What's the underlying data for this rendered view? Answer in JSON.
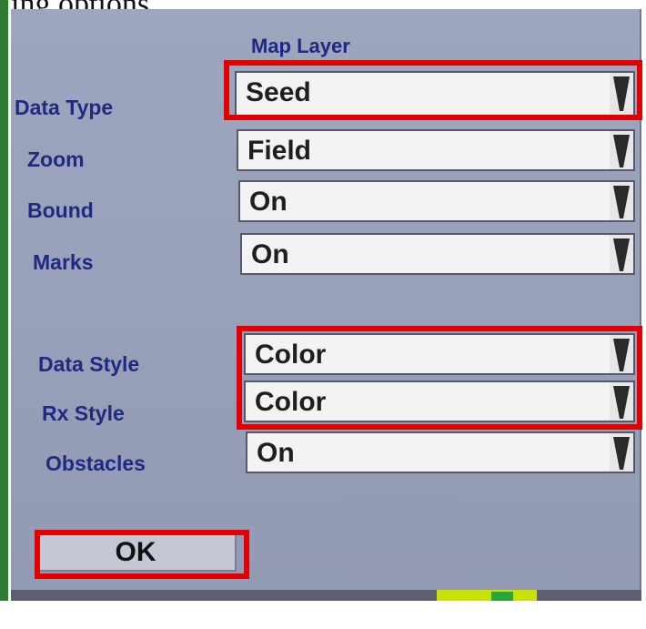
{
  "caption": "ing options",
  "dialog": {
    "title": "Map Layer",
    "rows": [
      {
        "label": "Data Type",
        "value": "Seed"
      },
      {
        "label": "Zoom",
        "value": "Field"
      },
      {
        "label": "Bound",
        "value": "On"
      },
      {
        "label": "Marks",
        "value": "On"
      },
      {
        "label": "Data Style",
        "value": "Color"
      },
      {
        "label": "Rx Style",
        "value": "Color"
      },
      {
        "label": "Obstacles",
        "value": "On"
      }
    ],
    "ok_label": "OK"
  },
  "colors": {
    "highlight": "#e30000",
    "label_text": "#1f2a80",
    "dialog_bg": "#9ea6bf"
  }
}
